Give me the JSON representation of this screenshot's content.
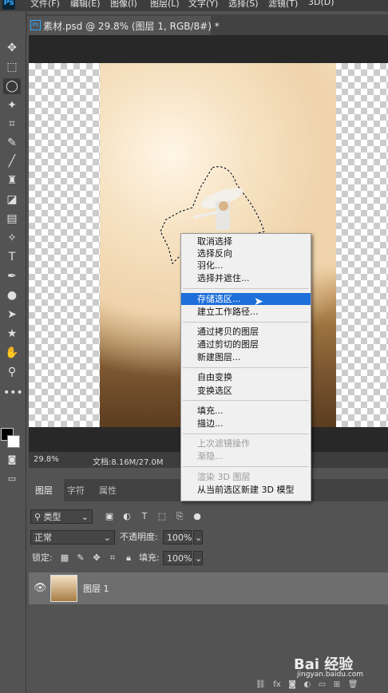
{
  "menubar": {
    "items": [
      "文件(F)",
      "编辑(E)",
      "图像(I)",
      "图层(L)",
      "文字(Y)",
      "选择(S)",
      "滤镜(T)",
      "3D(D)"
    ]
  },
  "document": {
    "tab_title": "素材.psd @ 29.8% (图层 1, RGB/8#) *",
    "zoom": "29.8%",
    "doc_info": "文档:8.16M/27.0M"
  },
  "toolbar": {
    "tools": [
      "move-icon",
      "marquee-icon",
      "lasso-icon",
      "magic-wand-icon",
      "crop-icon",
      "eyedropper-icon",
      "brush-icon",
      "stamp-icon",
      "eraser-icon",
      "gradient-icon",
      "blur-icon",
      "type-icon",
      "pen-icon",
      "dodge-icon",
      "path-select-icon",
      "shape-icon",
      "hand-icon",
      "zoom-icon",
      "more-icon"
    ]
  },
  "context_menu": {
    "groups": [
      [
        "取消选择",
        "选择反向",
        "羽化...",
        "选择并遮住..."
      ],
      [
        "存储选区...",
        "建立工作路径..."
      ],
      [
        "通过拷贝的图层",
        "通过剪切的图层",
        "新建图层..."
      ],
      [
        "自由变换",
        "变换选区"
      ],
      [
        "填充...",
        "描边..."
      ],
      [
        "上次滤镜操作",
        "渐隐..."
      ],
      [
        "渲染 3D 图层",
        "从当前选区新建 3D 模型"
      ]
    ],
    "highlighted": "存储选区...",
    "disabled": [
      "上次滤镜操作",
      "渐隐...",
      "渲染 3D 图层"
    ]
  },
  "layers_panel": {
    "tabs": [
      "图层",
      "字符",
      "属性"
    ],
    "filter_kind": "类型",
    "blend_mode": "正常",
    "opacity_label": "不透明度:",
    "opacity_value": "100%",
    "lock_label": "锁定:",
    "fill_label": "填充:",
    "fill_value": "100%",
    "layers": [
      {
        "name": "图层 1"
      }
    ]
  },
  "watermark": {
    "brand": "Bai 经验",
    "url": "jingyan.baidu.com"
  },
  "colors": {
    "highlight": "#1e6fd9",
    "panel_bg": "#535353",
    "menu_bg": "#f0f0f0"
  }
}
